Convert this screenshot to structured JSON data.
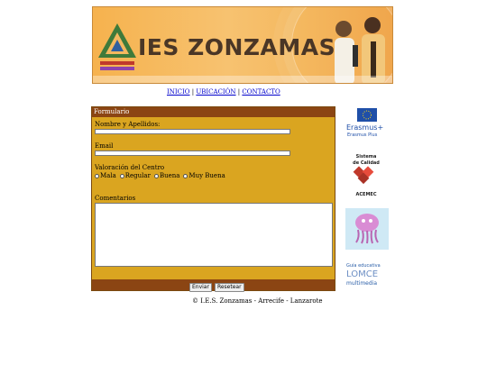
{
  "banner": {
    "title": "IES ZONZAMAS"
  },
  "nav": {
    "items": [
      "INICIO",
      "UBICACIÓN",
      "CONTACTO"
    ],
    "separator": "|"
  },
  "form": {
    "header": "Formulario",
    "name_label": "Nombre y Apellidos:",
    "name_value": "",
    "email_label": "Email",
    "email_value": "",
    "rating_label": "Valoración del Centro",
    "rating_options": [
      "Mala",
      "Regular",
      "Buena",
      "Muy Buena"
    ],
    "comments_label": "Comentarios",
    "comments_value": "",
    "submit_label": "Enviar",
    "reset_label": "Resetear"
  },
  "footer": {
    "text": "© I.E.S. Zonzamas - Arrecife - Lanzarote"
  },
  "sidebar": {
    "erasmus_name": "Erasmus+",
    "erasmus_sub": "Erasmus Plus",
    "calidad_line1": "Sistema",
    "calidad_line2": "de Calidad",
    "calidad_org": "ACEMEC",
    "guia_line1": "Guía educativa",
    "guia_line2": "LOMCE",
    "guia_line3": "multimedia"
  },
  "colors": {
    "form_bg": "#daa520",
    "form_bar": "#8b4513",
    "link": "#0000cc",
    "banner": "#f6b24e"
  }
}
